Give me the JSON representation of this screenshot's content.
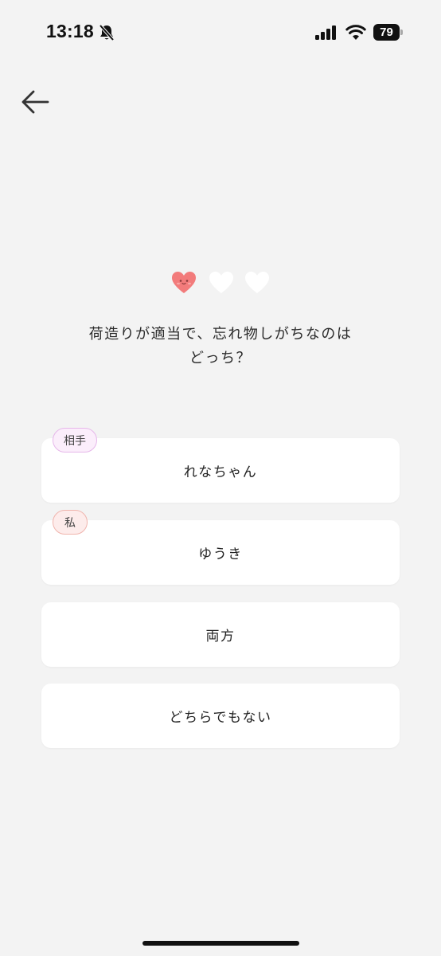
{
  "status_bar": {
    "time": "13:18",
    "battery_percent": "79",
    "icons": [
      "bell-slash-icon",
      "cellular-signal-icon",
      "wifi-icon",
      "battery-icon"
    ]
  },
  "nav": {
    "back_icon": "arrow-left-icon"
  },
  "progress": {
    "total": 3,
    "current": 1,
    "filled_color": "#f27b7b",
    "empty_color": "#ffffff"
  },
  "question": {
    "line1": "荷造りが適当で、忘れ物しがちなのは",
    "line2": "どっち？"
  },
  "options": [
    {
      "label": "れなちゃん",
      "badge": "相手"
    },
    {
      "label": "ゆうき",
      "badge": "私"
    },
    {
      "label": "両方"
    },
    {
      "label": "どちらでもない"
    }
  ],
  "colors": {
    "background": "#f3f3f3",
    "card": "#ffffff",
    "badge_partner_border": "#e6b7ea",
    "badge_me_border": "#f0b4ad"
  }
}
